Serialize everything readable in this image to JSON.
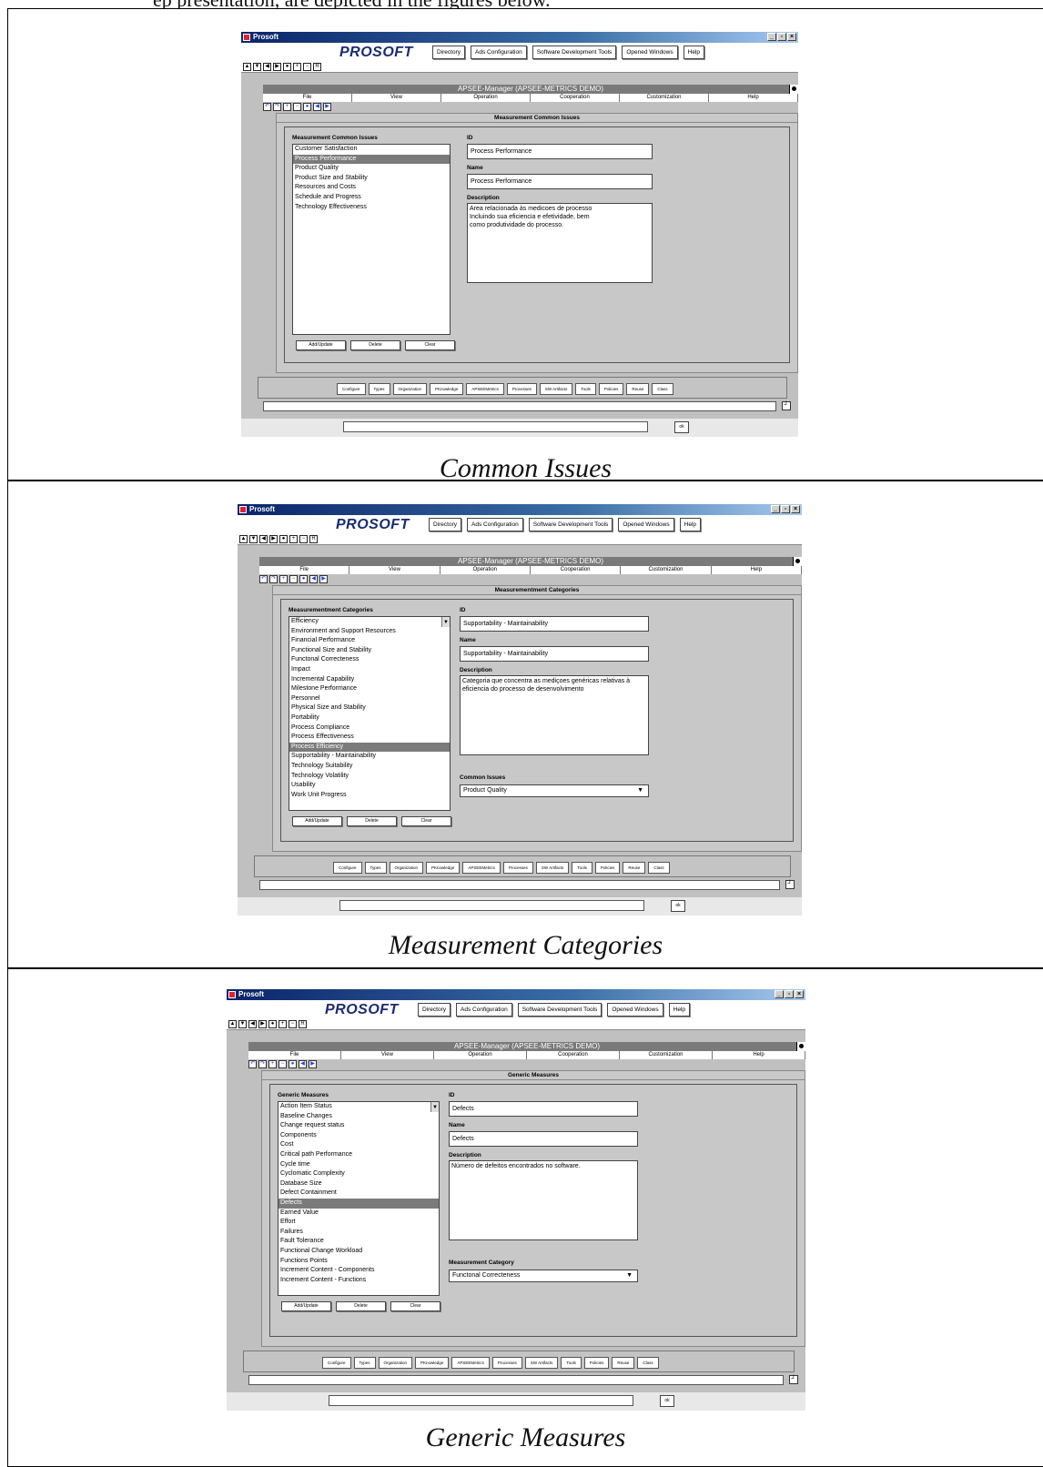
{
  "top_cut_text": "ep presentation, are depicted in the figures below.",
  "window": {
    "title": "Prosoft",
    "logo": "PROSOFT",
    "top_buttons": [
      "Directory",
      "Ads Configuration",
      "Software Development Tools",
      "Opened Windows",
      "Help"
    ],
    "nav_buttons": [
      "▲",
      "▼",
      "◀",
      "▶",
      "●",
      "+",
      "−",
      "R"
    ],
    "manager_title": "APSEE-Manager (APSEE-METRICS DEMO)",
    "menu": [
      "File",
      "View",
      "Operation",
      "Cooperation",
      "Customization",
      "Help"
    ],
    "tool_icons": [
      "↶",
      "↷",
      "+",
      "−",
      "●",
      "◀",
      "▶"
    ],
    "bottom_tabs": [
      "Configure",
      "Types",
      "Organization",
      "PKnowledge",
      "APSEEMetrics",
      "Processes",
      "SW Artifacts",
      "Tools",
      "Policies",
      "Reuse",
      "Class"
    ],
    "action_buttons": [
      "Add/Update",
      "Delete",
      "Clear"
    ],
    "ok_label": "ok",
    "win_buttons": [
      "_",
      "▫",
      "×"
    ]
  },
  "panels": [
    {
      "caption": "Common Issues",
      "form_title": "Measurement Common Issues",
      "list_label": "Measurement Common Issues",
      "list_items": [
        "Customer Satisfaction",
        "Process Performance",
        "Product Quality",
        "Product Size and Stability",
        "Resources and Costs",
        "Schedule and Progress",
        "Technology Effectiveness"
      ],
      "selected_index": 1,
      "id_label": "ID",
      "id_value": "Process Performance",
      "name_label": "Name",
      "name_value": "Process Performance",
      "desc_label": "Description",
      "desc_value": "Area relacionada às medicoes de processo\nIncluindo sua eficiencia e efetividade, bem\ncomo produtividade do processo."
    },
    {
      "caption": "Measurement Categories",
      "form_title": "Measurementment Categories",
      "list_label": "Measurementment Categories",
      "list_items": [
        "Efficiency",
        "Environment and Support Resources",
        "Financial Performance",
        "Functional Size and Stability",
        "Functonal Correcteness",
        "Impact",
        "Incremental Capability",
        "Milestone Performance",
        "Personnel",
        "Physical Size and Stability",
        "Portability",
        "Process Compliance",
        "Process Effectiveness",
        "Process Efficiency",
        "Supportability - Maintainability",
        "Technology Suitability",
        "Technology Volatility",
        "Usability",
        "Work Unit Progress"
      ],
      "selected_index": 13,
      "id_label": "ID",
      "id_value": "Supportability - Maintainability",
      "name_label": "Name",
      "name_value": "Supportability - Maintainability",
      "desc_label": "Description",
      "desc_value": "Categoria que concentra as mediçoes genéricas relativas à\neficiencia do processo de desenvolvimento",
      "select_label": "Common Issues",
      "select_value": "Product Quality"
    },
    {
      "caption": "Generic Measures",
      "form_title": "Generic Measures",
      "list_label": "Generic Measures",
      "list_items": [
        "Action Item Status",
        "Baseline Changes",
        "Change request status",
        "Components",
        "Cost",
        "Critical path Performance",
        "Cycle time",
        "Cyclomatic Complexity",
        "Database Size",
        "Defect Containment",
        "Defects",
        "Earned Value",
        "Effort",
        "Failures",
        "Fault Tolerance",
        "Functional Change Workload",
        "Functions Points",
        "Increment Content - Components",
        "Increment Content - Functions"
      ],
      "selected_index": 10,
      "id_label": "ID",
      "id_value": "Defects",
      "name_label": "Name",
      "name_value": "Defects",
      "desc_label": "Description",
      "desc_value": "Número de defeitos encontrados no software.",
      "select_label": "Measurement Category",
      "select_value": "Functonal Correcteness"
    }
  ]
}
